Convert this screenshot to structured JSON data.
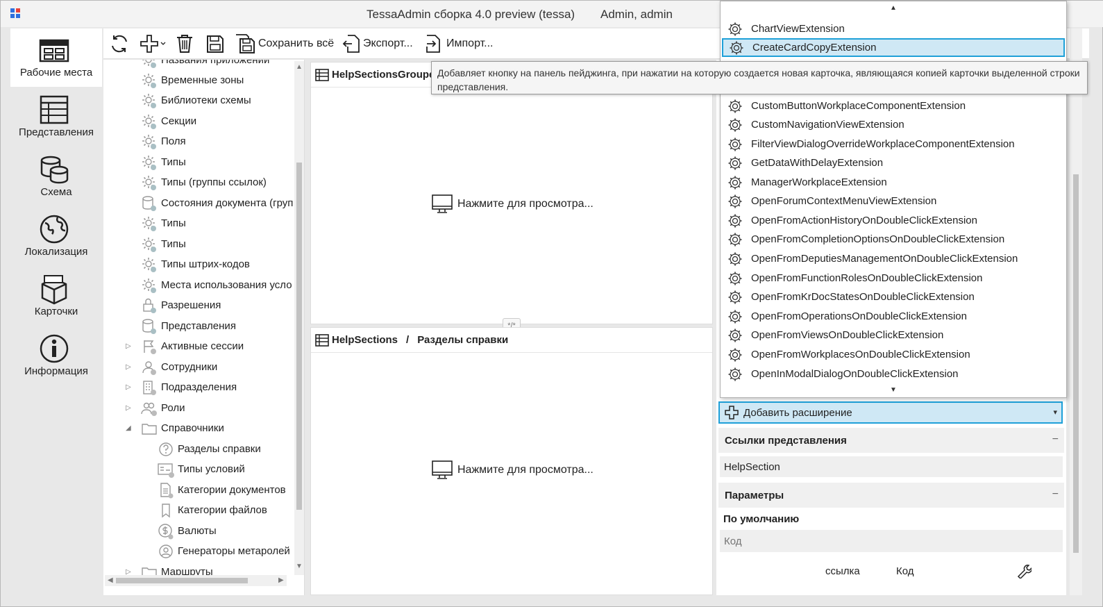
{
  "window": {
    "title": "TessaAdmin сборка 4.0 preview (tessa)",
    "user": "Admin, admin"
  },
  "leftnav": {
    "items": [
      {
        "label": "Рабочие места",
        "icon": "workplaces-icon",
        "active": true
      },
      {
        "label": "Представления",
        "icon": "views-icon"
      },
      {
        "label": "Схема",
        "icon": "schema-icon"
      },
      {
        "label": "Локализация",
        "icon": "localization-icon"
      },
      {
        "label": "Карточки",
        "icon": "cards-icon"
      },
      {
        "label": "Информация",
        "icon": "info-icon"
      }
    ]
  },
  "toolbar": {
    "save_all": "Сохранить всё",
    "export": "Экспорт...",
    "import": "Импорт..."
  },
  "tree": {
    "items": [
      {
        "label": "Названия приложений"
      },
      {
        "label": "Временные зоны"
      },
      {
        "label": "Библиотеки схемы"
      },
      {
        "label": "Секции"
      },
      {
        "label": "Поля"
      },
      {
        "label": "Типы"
      },
      {
        "label": "Типы (группы ссылок)"
      },
      {
        "label": "Состояния документа (груп"
      },
      {
        "label": "Типы"
      },
      {
        "label": "Типы"
      },
      {
        "label": "Типы штрих-кодов"
      },
      {
        "label": "Места использования усло"
      },
      {
        "label": "Разрешения"
      },
      {
        "label": "Представления"
      },
      {
        "label": "Активные сессии"
      },
      {
        "label": "Сотрудники"
      },
      {
        "label": "Подразделения"
      },
      {
        "label": "Роли"
      },
      {
        "label": "Справочники"
      },
      {
        "label": "Разделы справки"
      },
      {
        "label": "Типы условий"
      },
      {
        "label": "Категории документов"
      },
      {
        "label": "Категории файлов"
      },
      {
        "label": "Валюты"
      },
      {
        "label": "Генераторы метаролей"
      },
      {
        "label": "Маршруты"
      }
    ]
  },
  "center": {
    "top_panel_title": "HelpSectionsGrouped",
    "bottom_panel_title": "HelpSections",
    "bottom_panel_sep": "/",
    "bottom_panel_subtitle": "Разделы справки",
    "click_to_view": "Нажмите для просмотра...",
    "splitter_label": "*/*"
  },
  "dropdown": {
    "items": [
      "ChartViewExtension",
      "CreateCardCopyExtension",
      "CustomButtonWorkplaceComponentExtension",
      "CustomNavigationViewExtension",
      "FilterViewDialogOverrideWorkplaceComponentExtension",
      "GetDataWithDelayExtension",
      "ManagerWorkplaceExtension",
      "OpenForumContextMenuViewExtension",
      "OpenFromActionHistoryOnDoubleClickExtension",
      "OpenFromCompletionOptionsOnDoubleClickExtension",
      "OpenFromDeputiesManagementOnDoubleClickExtension",
      "OpenFromFunctionRolesOnDoubleClickExtension",
      "OpenFromKrDocStatesOnDoubleClickExtension",
      "OpenFromOperationsOnDoubleClickExtension",
      "OpenFromViewsOnDoubleClickExtension",
      "OpenFromWorkplacesOnDoubleClickExtension",
      "OpenInModalDialogOnDoubleClickExtension"
    ],
    "selected": "CreateCardCopyExtension"
  },
  "tooltip": {
    "text": "Добавляет кнопку на панель пейджинга, при нажатии на которую создается новая карточка, являющаяся копией карточки выделенной строки представления."
  },
  "right": {
    "add_extension": "Добавить расширение",
    "view_links_title": "Ссылки представления",
    "view_link_value": "HelpSection",
    "params_title": "Параметры",
    "default_label": "По умолчанию",
    "code_placeholder": "Код",
    "footer_link": "ссылка",
    "footer_code": "Код",
    "collapse_symbol": "−"
  },
  "colors": {
    "accent": "#1ea0d8",
    "selection_bg": "#cfe8f5",
    "logo_red": "#e8423a",
    "logo_blue": "#2f6fde"
  }
}
